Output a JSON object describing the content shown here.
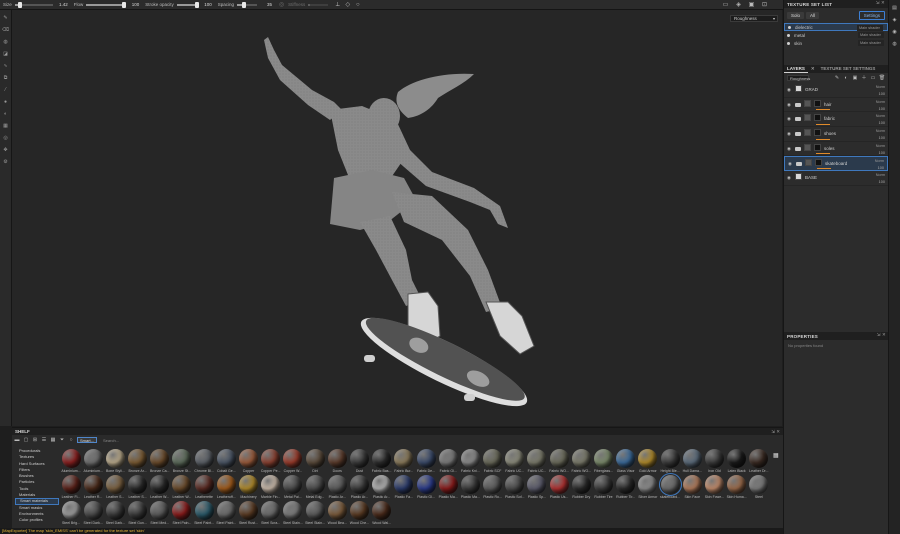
{
  "toolbar": {
    "size_label": "Size",
    "size_value": "1.42",
    "size_fill": 0.15,
    "flow_label": "Flow",
    "flow_value": "100",
    "flow_fill": 1.0,
    "stroke_label": "Stroke opacity",
    "stroke_value": "100",
    "stroke_fill": 1.0,
    "spacing_label": "Spacing",
    "spacing_value": "35",
    "spacing_fill": 0.35,
    "disabled_label": "Stiffness",
    "disabled_fill": 0.1
  },
  "viewport": {
    "channel_select": "Roughness"
  },
  "texture_set_list": {
    "title": "TEXTURE SET LIST",
    "tabs": [
      "Solo",
      "All"
    ],
    "settings_label": "Settings",
    "sets": [
      {
        "name": "dielectric",
        "shader": "Main shader",
        "selected": true
      },
      {
        "name": "metal",
        "shader": "Main shader",
        "selected": false
      },
      {
        "name": "skin",
        "shader": "Main shader",
        "selected": false
      }
    ]
  },
  "layers_panel": {
    "tabs": [
      "LAYERS",
      "TEXTURE SET SETTINGS"
    ],
    "channel": "Roughness",
    "layers": [
      {
        "name": "GRAD",
        "blend": "Norm",
        "opacity": "100",
        "type": "fill",
        "selected": false,
        "mask": false
      },
      {
        "name": "hair",
        "blend": "Norm",
        "opacity": "100",
        "type": "folder",
        "selected": false,
        "mask": true
      },
      {
        "name": "fabric",
        "blend": "Norm",
        "opacity": "100",
        "type": "folder",
        "selected": false,
        "mask": true
      },
      {
        "name": "shoes",
        "blend": "Norm",
        "opacity": "100",
        "type": "folder",
        "selected": false,
        "mask": true
      },
      {
        "name": "soles",
        "blend": "Norm",
        "opacity": "100",
        "type": "folder",
        "selected": false,
        "mask": true
      },
      {
        "name": "skateboard",
        "blend": "Norm",
        "opacity": "100",
        "type": "folder",
        "selected": true,
        "mask": true
      },
      {
        "name": "BASE",
        "blend": "Norm",
        "opacity": "100",
        "type": "fill",
        "selected": false,
        "mask": false
      }
    ]
  },
  "properties": {
    "title": "PROPERTIES",
    "empty_text": "No properties found"
  },
  "shelf": {
    "title": "SHELF",
    "filter_chip": "Smart...",
    "search_placeholder": "Search...",
    "categories": [
      "Procedurals",
      "Textures",
      "Hard Surfaces",
      "Filters",
      "Brushes",
      "Particles",
      "Tools",
      "Materials",
      "Smart materials",
      "Smart masks",
      "Environments",
      "Color profiles"
    ],
    "selected_category": "Smart materials",
    "materials": [
      {
        "label": "Aluminium...",
        "color": "#8a1f1f"
      },
      {
        "label": "Aluminium...",
        "color": "#6e6e6e"
      },
      {
        "label": "Bone Styli...",
        "color": "#b9a98a"
      },
      {
        "label": "Bronze Ar...",
        "color": "#7a5a32"
      },
      {
        "label": "Bronze Ca...",
        "color": "#6a4a2a"
      },
      {
        "label": "Bronze St...",
        "color": "#5c6b5a"
      },
      {
        "label": "Chrome Bl...",
        "color": "#5a5f66"
      },
      {
        "label": "Cobalt Ge...",
        "color": "#4a5565"
      },
      {
        "label": "Copper",
        "color": "#9a5a3a"
      },
      {
        "label": "Copper Pe...",
        "color": "#8a4030"
      },
      {
        "label": "Copper W...",
        "color": "#9a3a2a"
      },
      {
        "label": "Dirt",
        "color": "#5a4a3a"
      },
      {
        "label": "Doors",
        "color": "#5a3a2a"
      },
      {
        "label": "Dust",
        "color": "#3a3a3a"
      },
      {
        "label": "Fabric Bas...",
        "color": "#2c2c2c"
      },
      {
        "label": "Fabric Bur...",
        "color": "#8a7a5a"
      },
      {
        "label": "Fabric De...",
        "color": "#3a4a6a"
      },
      {
        "label": "Fabric Gl...",
        "color": "#7a7a7a"
      },
      {
        "label": "Fabric Kni...",
        "color": "#8a8a8a"
      },
      {
        "label": "Fabric SCF",
        "color": "#6a6a5a"
      },
      {
        "label": "Fabric UC...",
        "color": "#8a8a7a"
      },
      {
        "label": "Fabric UC...",
        "color": "#7a7a6a"
      },
      {
        "label": "Fabric WO...",
        "color": "#6a6a5a"
      },
      {
        "label": "Fabric WO...",
        "color": "#7a7a6a"
      },
      {
        "label": "Fiberglass...",
        "color": "#7a8a6a"
      },
      {
        "label": "Glass Visor",
        "color": "#3a6a9a"
      },
      {
        "label": "Gold Armor",
        "color": "#b08a2a"
      },
      {
        "label": "Height Ble...",
        "color": "#3a3a3a"
      },
      {
        "label": "Hull Dama...",
        "color": "#5a6a7a"
      },
      {
        "label": "Iron Old",
        "color": "#3a3a3a"
      },
      {
        "label": "Latex Black",
        "color": "#1a1a1a"
      },
      {
        "label": "Leather Dr...",
        "color": "#3a2a22"
      },
      {
        "label": "Leather Fi...",
        "color": "#5a2018"
      },
      {
        "label": "Leather R...",
        "color": "#4a2a1a"
      },
      {
        "label": "Leather S...",
        "color": "#7a6040"
      },
      {
        "label": "Leather S...",
        "color": "#2a2a2a"
      },
      {
        "label": "Leather W...",
        "color": "#2a2a2a"
      },
      {
        "label": "Leather W...",
        "color": "#6a4a2a"
      },
      {
        "label": "Leatherette",
        "color": "#5a2a22"
      },
      {
        "label": "Leatheroff...",
        "color": "#a05a1a"
      },
      {
        "label": "Machinery",
        "color": "#b08a2a"
      },
      {
        "label": "Marble Fin...",
        "color": "#c8b8a8"
      },
      {
        "label": "Metal Pai...",
        "color": "#4a4a4a"
      },
      {
        "label": "Metal Edg...",
        "color": "#4a4a4a"
      },
      {
        "label": "Plastic Ar...",
        "color": "#5a5a5a"
      },
      {
        "label": "Plastic Ar...",
        "color": "#3a3a3a"
      },
      {
        "label": "Plastic Ar...",
        "color": "#b0b0b0"
      },
      {
        "label": "Plastic Fa...",
        "color": "#2a3a6a"
      },
      {
        "label": "Plastic Gl...",
        "color": "#2a3a8a"
      },
      {
        "label": "Plastic Ma...",
        "color": "#8a1a1a"
      },
      {
        "label": "Plastic Ma...",
        "color": "#3a3a3a"
      },
      {
        "label": "Plastic Ro...",
        "color": "#5a5a5a"
      },
      {
        "label": "Plastic Sof...",
        "color": "#4a4a4a"
      },
      {
        "label": "Plastic Sp...",
        "color": "#5a5a6a"
      },
      {
        "label": "Plastic Us...",
        "color": "#b03030"
      },
      {
        "label": "Rubber Dry",
        "color": "#2a2a2a"
      },
      {
        "label": "Rubber Tire",
        "color": "#3a3a3a"
      },
      {
        "label": "Rubber Tir...",
        "color": "#2a2a2a"
      },
      {
        "label": "Silver Armor",
        "color": "#8a8a8a"
      },
      {
        "label": "skateboard...",
        "color": "#6a6a6a"
      },
      {
        "label": "Skin Face",
        "color": "#b07a5a"
      },
      {
        "label": "Skin Fowe...",
        "color": "#c08a6a"
      },
      {
        "label": "Skin Huma...",
        "color": "#9a6a4a"
      },
      {
        "label": "Steel",
        "color": "#7a7a7a"
      },
      {
        "label": "Steel Brig...",
        "color": "#9a9a9a"
      },
      {
        "label": "Steel Dark...",
        "color": "#4a4a4a"
      },
      {
        "label": "Steel Dark...",
        "color": "#3a3a3a"
      },
      {
        "label": "Steel Gun...",
        "color": "#3a3a3a"
      },
      {
        "label": "Steel Med...",
        "color": "#5a5a5a"
      },
      {
        "label": "Steel Pain...",
        "color": "#8a1a1a"
      },
      {
        "label": "Steel Paint...",
        "color": "#2a5a6a"
      },
      {
        "label": "Steel Paint...",
        "color": "#6a6a6a"
      },
      {
        "label": "Steel Rust...",
        "color": "#5a3a22"
      },
      {
        "label": "Steel Scra...",
        "color": "#6a6a6a"
      },
      {
        "label": "Steel Stain...",
        "color": "#7a7a7a"
      },
      {
        "label": "Steel Stain...",
        "color": "#5a5a5a"
      },
      {
        "label": "Wood Bea...",
        "color": "#7a5a3a"
      },
      {
        "label": "Wood Che...",
        "color": "#5a3a22"
      },
      {
        "label": "Wood Wal...",
        "color": "#4a2a1a"
      }
    ],
    "selected_material": "skateboard..."
  },
  "status": {
    "message": "[MapExporter] The map 'skin_EMISS' can't be generated for the texture set 'skin'"
  },
  "colors": {
    "accent": "#3f78bd",
    "warning": "#e7b73a",
    "layer_mask_indicator": "#e08a2a"
  }
}
